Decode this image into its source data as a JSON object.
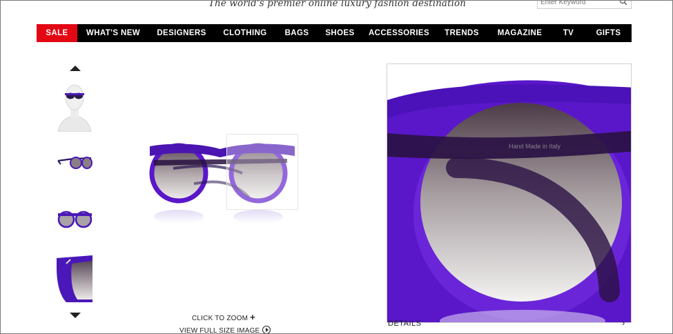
{
  "header": {
    "tagline": "The world's premier online luxury fashion destination",
    "search": {
      "placeholder": "Enter Keyword",
      "icon": "search-icon"
    }
  },
  "nav": {
    "sale_color": "#e30613",
    "items": [
      {
        "label": "SALE"
      },
      {
        "label": "WHAT'S NEW"
      },
      {
        "label": "DESIGNERS"
      },
      {
        "label": "CLOTHING"
      },
      {
        "label": "BAGS"
      },
      {
        "label": "SHOES"
      },
      {
        "label": "ACCESSORIES"
      },
      {
        "label": "TRENDS"
      },
      {
        "label": "MAGAZINE"
      },
      {
        "label": "TV"
      },
      {
        "label": "GIFTS"
      }
    ]
  },
  "gallery": {
    "thumbnails": [
      "model wearing sunglasses",
      "sunglasses side view",
      "sunglasses front view",
      "sunglasses detail"
    ],
    "zoom_label": "CLICK TO ZOOM",
    "fullsize_label": "VIEW FULL SIZE IMAGE",
    "frame_color": "#5a17c9"
  },
  "zoom_panel": {
    "temple_text": "Hand Made in Italy"
  },
  "details": {
    "label": "DETAILS"
  }
}
